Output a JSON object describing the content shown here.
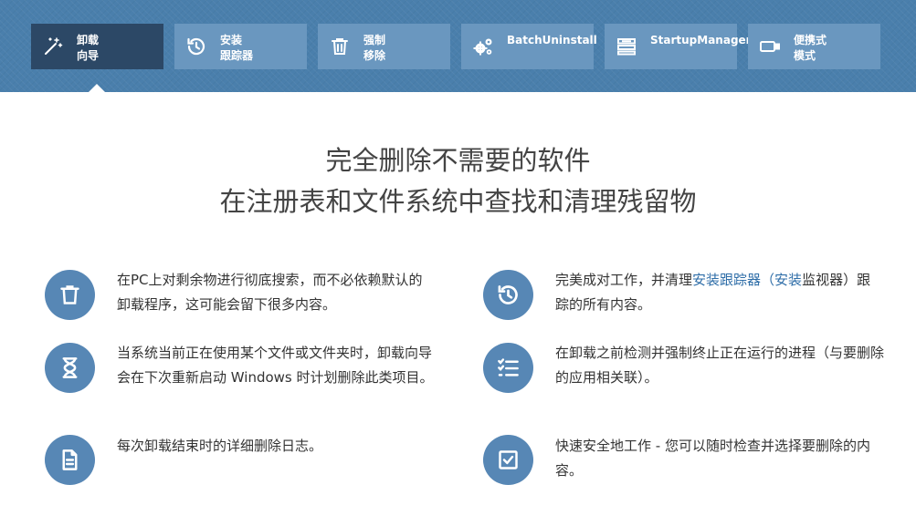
{
  "tabs": [
    {
      "label": "卸载\n向导",
      "icon": "magic-wand-icon",
      "active": true
    },
    {
      "label": "安装\n跟踪器",
      "icon": "history-icon",
      "active": false
    },
    {
      "label": "强制\n移除",
      "icon": "trash-icon",
      "active": false
    },
    {
      "label": "BatchUninstall",
      "icon": "gears-icon",
      "active": false
    },
    {
      "label": "StartupManager",
      "icon": "startup-list-icon",
      "active": false
    },
    {
      "label": "便携式\n模式",
      "icon": "usb-drive-icon",
      "active": false
    }
  ],
  "headline": {
    "line1": "完全删除不需要的软件",
    "line2": "在注册表和文件系统中查找和清理残留物"
  },
  "features": {
    "left": [
      {
        "icon": "trash-icon",
        "text": "在PC上对剩余物进行彻底搜索，而不必依赖默认的卸载程序，这可能会留下很多内容。"
      },
      {
        "icon": "hourglass-icon",
        "text": "当系统当前正在使用某个文件或文件夹时，卸载向导会在下次重新启动 Windows 时计划删除此类项目。"
      },
      {
        "icon": "document-icon",
        "text": "每次卸载结束时的详细删除日志。"
      }
    ],
    "right": [
      {
        "icon": "history-icon",
        "text_before": "完美成对工作，并清理",
        "link1": "安装跟踪器",
        "paren_open": "（",
        "link2": "安装",
        "text_after": "监视器）跟踪的所有内容。"
      },
      {
        "icon": "checklist-icon",
        "text": "在卸载之前检测并强制终止正在运行的进程（与要删除的应用相关联）。"
      },
      {
        "icon": "checkbox-icon",
        "text": "快速安全地工作 - 您可以随时检查并选择要删除的内容。"
      }
    ]
  },
  "colors": {
    "topbar": "#4a7fac",
    "tab": "#6a97bf",
    "tab_active": "#2c4866",
    "feature_icon": "#5787b5",
    "link": "#2f6ea8"
  }
}
